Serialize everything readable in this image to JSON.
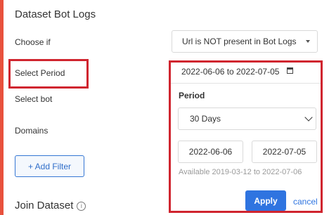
{
  "panel": {
    "title": "Dataset Bot Logs",
    "choose_label": "Choose if",
    "choose_value": "Url is NOT present in Bot Logs",
    "select_period_label": "Select Period",
    "select_bot_label": "Select bot",
    "domains_label": "Domains",
    "add_filter": "+ Add Filter",
    "join_title": "Join Dataset",
    "info_glyph": "i"
  },
  "date_picker": {
    "range_display": "2022-06-06 to 2022-07-05",
    "period_label": "Period",
    "period_value": "30 Days",
    "start_date": "2022-06-06",
    "end_date": "2022-07-05",
    "available": "Available 2019-03-12 to 2022-07-06",
    "apply_label": "Apply",
    "cancel_label": "cancel"
  },
  "colors": {
    "accent": "#e8513d",
    "highlight_box": "#d0252f",
    "primary": "#2f74e0"
  }
}
